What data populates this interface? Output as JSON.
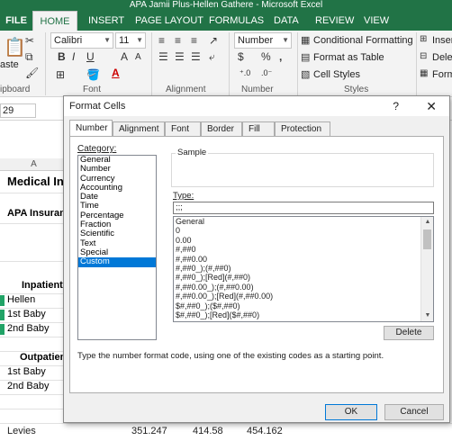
{
  "window": {
    "title": "APA Jamii Plus-Hellen Gathere - Microsoft Excel"
  },
  "ribbon_tabs": [
    "FILE",
    "HOME",
    "INSERT",
    "PAGE LAYOUT",
    "FORMULAS",
    "DATA",
    "REVIEW",
    "VIEW"
  ],
  "ribbon": {
    "clipboard": {
      "paste_label": "aste",
      "group_label": "ipboard"
    },
    "font": {
      "name": "Calibri",
      "size": "11",
      "group_label": "Font"
    },
    "alignment": {
      "group_label": "Alignment"
    },
    "number": {
      "format": "Number",
      "currency": "$",
      "percent": "%",
      "comma": ",",
      "group_label": "Number"
    },
    "styles": {
      "conditional": "Conditional Formatting",
      "format_table": "Format as Table",
      "cell_styles": "Cell Styles",
      "group_label": "Styles"
    },
    "cells": {
      "insert": "Inser",
      "delete": "Dele",
      "format": "Form"
    }
  },
  "formula_bar": {
    "name_box": "29"
  },
  "sheet": {
    "column_header": "A",
    "cells": [
      {
        "text": "Medical In",
        "bold": true
      },
      {
        "text": "APA Insuranc",
        "bold": true
      },
      {
        "text": "Inpatient",
        "bold": true
      },
      {
        "text": "Hellen"
      },
      {
        "text": "1st Baby"
      },
      {
        "text": "2nd Baby"
      },
      {
        "text": "Outpatien",
        "bold": true
      },
      {
        "text": "1st Baby"
      },
      {
        "text": "2nd Baby"
      }
    ],
    "bottom_row": {
      "label": "Levies",
      "values": [
        "351.247",
        "414.58",
        "454.162"
      ]
    }
  },
  "dialog": {
    "title": "Format Cells",
    "help": "?",
    "close": "✕",
    "tabs": [
      "Number",
      "Alignment",
      "Font",
      "Border",
      "Fill",
      "Protection"
    ],
    "active_tab": "Number",
    "category_label": "Category:",
    "categories": [
      "General",
      "Number",
      "Currency",
      "Accounting",
      "Date",
      "Time",
      "Percentage",
      "Fraction",
      "Scientific",
      "Text",
      "Special",
      "Custom"
    ],
    "selected_category": "Custom",
    "sample_label": "Sample",
    "type_label": "Type:",
    "type_value": ";;;",
    "formats": [
      "General",
      "0",
      "0.00",
      "#,##0",
      "#,##0.00",
      "#,##0_);(#,##0)",
      "#,##0_);[Red](#,##0)",
      "#,##0.00_);(#,##0.00)",
      "#,##0.00_);[Red](#,##0.00)",
      "$#,##0_);($#,##0)",
      "$#,##0_);[Red]($#,##0)"
    ],
    "delete_label": "Delete",
    "hint": "Type the number format code, using one of the existing codes as a starting point.",
    "ok_label": "OK",
    "cancel_label": "Cancel"
  }
}
